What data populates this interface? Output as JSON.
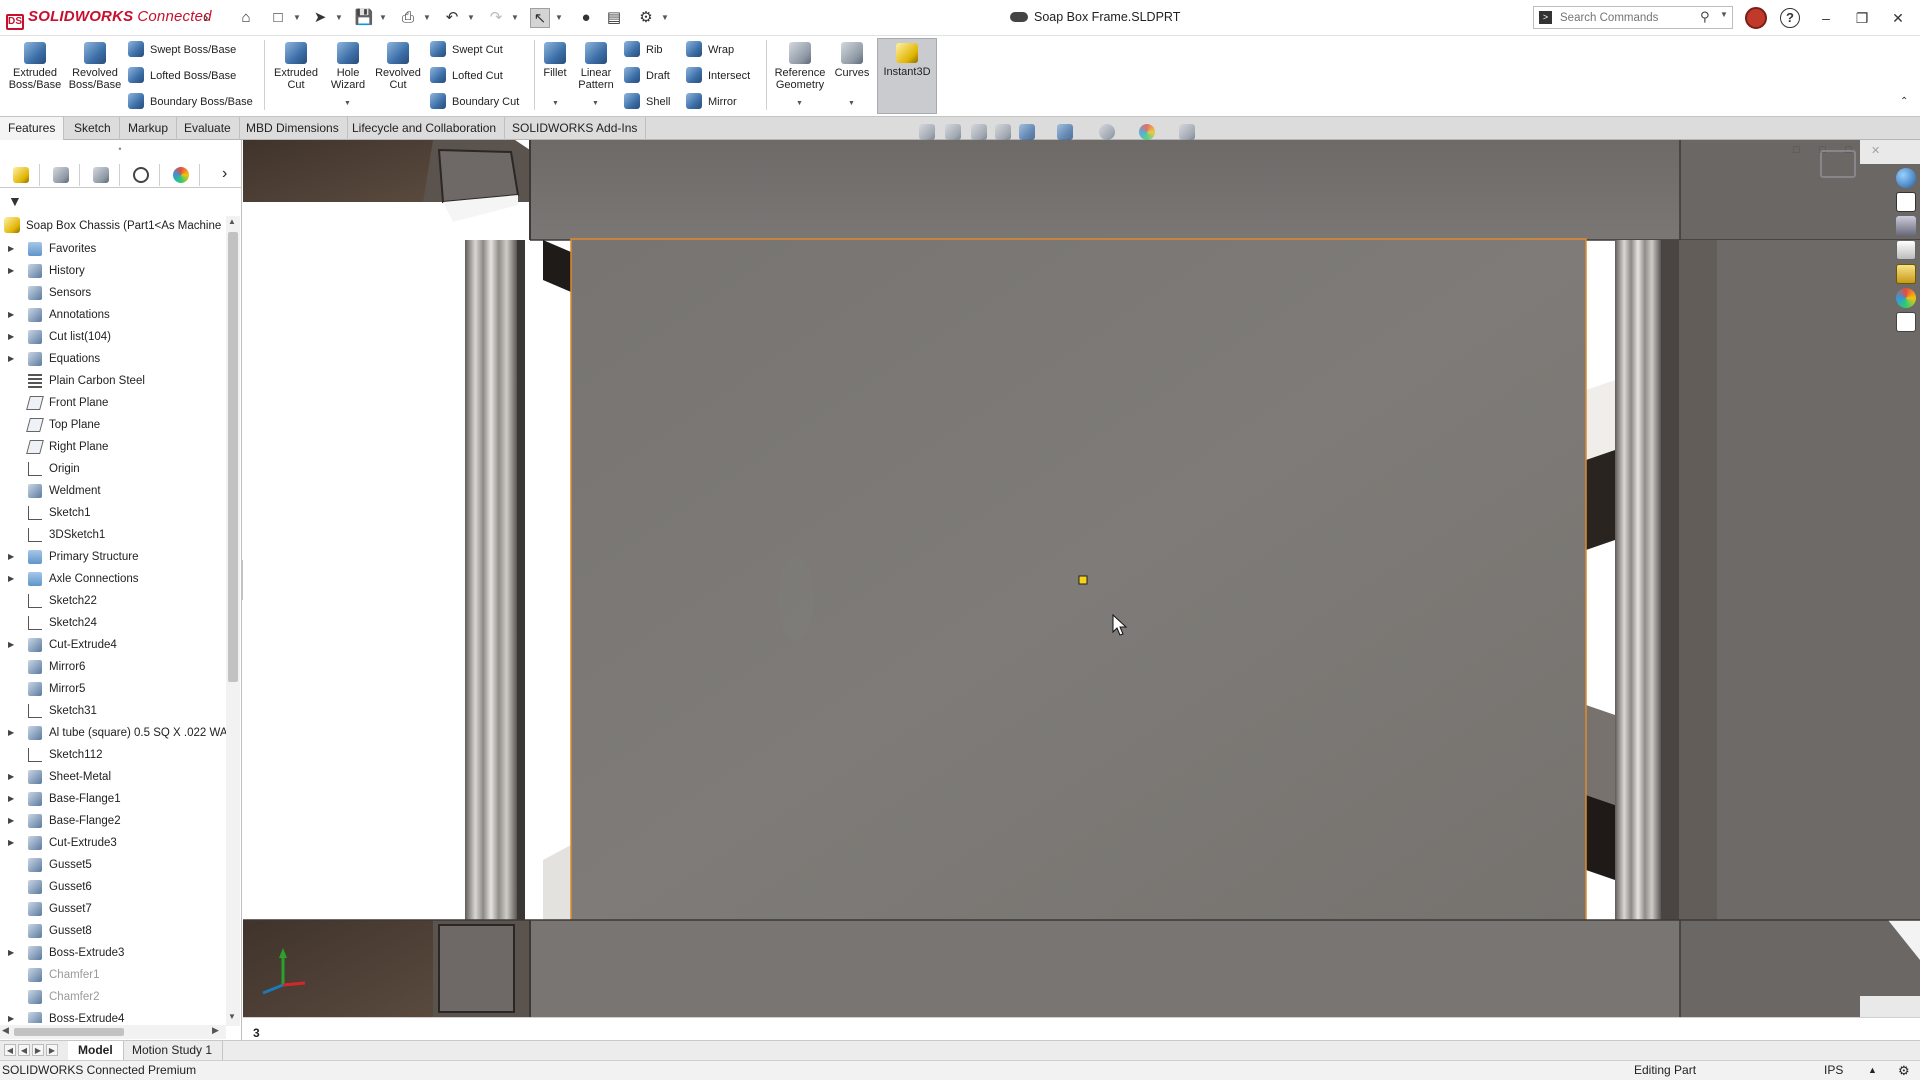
{
  "app": {
    "brand": "SOLIDWORKS",
    "edition_word": "Connected",
    "document_title": "Soap Box Frame.SLDPRT"
  },
  "search": {
    "placeholder": "Search Commands"
  },
  "toolbar": {
    "extruded_boss": "Extruded Boss/Base",
    "revolved_boss": "Revolved Boss/Base",
    "swept_boss": "Swept Boss/Base",
    "lofted_boss": "Lofted Boss/Base",
    "boundary_boss": "Boundary Boss/Base",
    "extruded_cut": "Extruded Cut",
    "hole_wizard": "Hole Wizard",
    "revolved_cut": "Revolved Cut",
    "swept_cut": "Swept Cut",
    "lofted_cut": "Lofted Cut",
    "boundary_cut": "Boundary Cut",
    "fillet": "Fillet",
    "linear_pattern": "Linear Pattern",
    "rib": "Rib",
    "draft": "Draft",
    "shell": "Shell",
    "wrap": "Wrap",
    "intersect": "Intersect",
    "mirror": "Mirror",
    "reference_geometry": "Reference Geometry",
    "curves": "Curves",
    "instant3d": "Instant3D"
  },
  "tabs": [
    "Features",
    "Sketch",
    "Markup",
    "Evaluate",
    "MBD Dimensions",
    "Lifecycle and Collaboration",
    "SOLIDWORKS Add-Ins"
  ],
  "tree": {
    "root": "Soap Box Chassis (Part1<As Machine",
    "items": [
      {
        "label": "Favorites",
        "expand": true,
        "icon": "folder"
      },
      {
        "label": "History",
        "expand": true,
        "icon": "feat"
      },
      {
        "label": "Sensors",
        "expand": false,
        "icon": "feat"
      },
      {
        "label": "Annotations",
        "expand": true,
        "icon": "feat"
      },
      {
        "label": "Cut list(104)",
        "expand": true,
        "icon": "feat"
      },
      {
        "label": "Equations",
        "expand": true,
        "icon": "feat"
      },
      {
        "label": "Plain Carbon Steel",
        "expand": false,
        "icon": "mat"
      },
      {
        "label": "Front Plane",
        "expand": false,
        "icon": "plane"
      },
      {
        "label": "Top Plane",
        "expand": false,
        "icon": "plane"
      },
      {
        "label": "Right Plane",
        "expand": false,
        "icon": "plane"
      },
      {
        "label": "Origin",
        "expand": false,
        "icon": "sketch"
      },
      {
        "label": "Weldment",
        "expand": false,
        "icon": "feat"
      },
      {
        "label": "Sketch1",
        "expand": false,
        "icon": "sketch"
      },
      {
        "label": "3DSketch1",
        "expand": false,
        "icon": "sketch"
      },
      {
        "label": "Primary Structure",
        "expand": true,
        "icon": "folder"
      },
      {
        "label": "Axle Connections",
        "expand": true,
        "icon": "folder"
      },
      {
        "label": "Sketch22",
        "expand": false,
        "icon": "sketch"
      },
      {
        "label": "Sketch24",
        "expand": false,
        "icon": "sketch"
      },
      {
        "label": "Cut-Extrude4",
        "expand": true,
        "icon": "feat"
      },
      {
        "label": "Mirror6",
        "expand": false,
        "icon": "feat"
      },
      {
        "label": "Mirror5",
        "expand": false,
        "icon": "feat"
      },
      {
        "label": "Sketch31",
        "expand": false,
        "icon": "sketch"
      },
      {
        "label": "Al tube (square) 0.5 SQ X .022 WA",
        "expand": true,
        "icon": "feat"
      },
      {
        "label": "Sketch112",
        "expand": false,
        "icon": "sketch"
      },
      {
        "label": "Sheet-Metal",
        "expand": true,
        "icon": "feat"
      },
      {
        "label": "Base-Flange1",
        "expand": true,
        "icon": "feat"
      },
      {
        "label": "Base-Flange2",
        "expand": true,
        "icon": "feat"
      },
      {
        "label": "Cut-Extrude3",
        "expand": true,
        "icon": "feat"
      },
      {
        "label": "Gusset5",
        "expand": false,
        "icon": "feat"
      },
      {
        "label": "Gusset6",
        "expand": false,
        "icon": "feat"
      },
      {
        "label": "Gusset7",
        "expand": false,
        "icon": "feat"
      },
      {
        "label": "Gusset8",
        "expand": false,
        "icon": "feat"
      },
      {
        "label": "Boss-Extrude3",
        "expand": true,
        "icon": "feat"
      },
      {
        "label": "Chamfer1",
        "expand": false,
        "icon": "feat",
        "dim": true
      },
      {
        "label": "Chamfer2",
        "expand": false,
        "icon": "feat",
        "dim": true
      },
      {
        "label": "Boss-Extrude4",
        "expand": true,
        "icon": "feat"
      }
    ]
  },
  "viewport": {
    "view_number": "3"
  },
  "model_tabs": [
    "Model",
    "Motion Study 1"
  ],
  "status": {
    "left": "SOLIDWORKS Connected Premium",
    "mode": "Editing Part",
    "units": "IPS"
  },
  "colors": {
    "brand": "#c8102e",
    "face_gray": "#7b7875",
    "selection_orange": "#e08a2c",
    "frame_brown": "#4a3b31"
  }
}
